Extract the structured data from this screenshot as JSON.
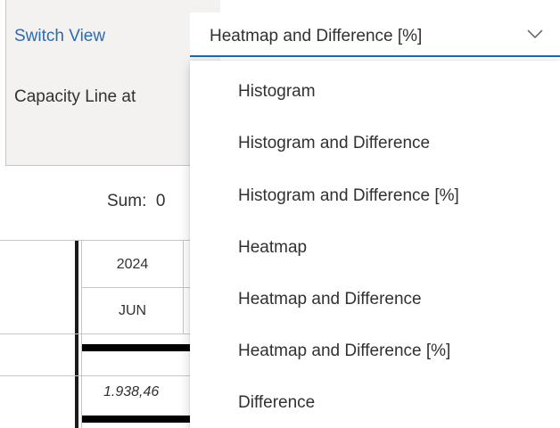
{
  "settings": {
    "switch_view_label": "Switch View",
    "capacity_line_label": "Capacity Line at"
  },
  "dropdown": {
    "selected": "Heatmap and Difference [%]",
    "icon": "chevron-down-icon",
    "options": [
      "Histogram",
      "Histogram and Difference",
      "Histogram and Difference [%]",
      "Heatmap",
      "Heatmap and Difference",
      "Heatmap and Difference [%]",
      "Difference"
    ]
  },
  "summary": {
    "sum_label": "Sum:",
    "sum_value": "0"
  },
  "grid": {
    "year": "2024",
    "month": "JUN",
    "value": "1.938,46"
  },
  "colors": {
    "accent": "#0f6cbd",
    "link": "#2b6cb0",
    "panel_bg": "#f3f2f1"
  }
}
